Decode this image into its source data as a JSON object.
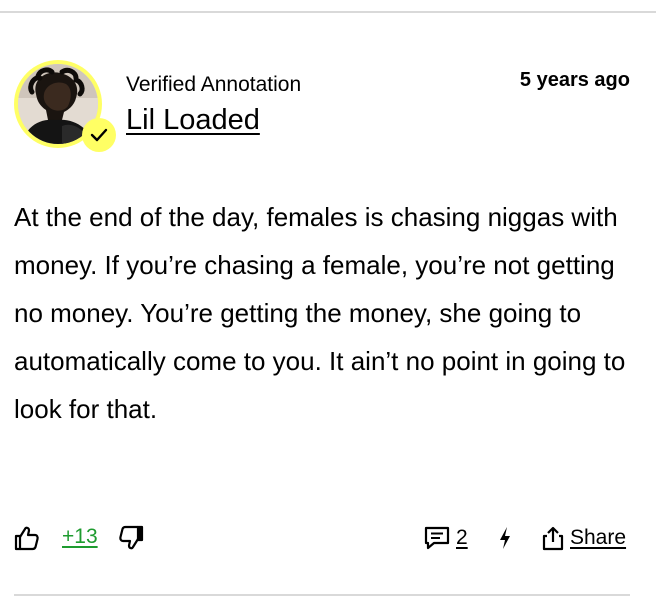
{
  "annotation": {
    "verified_label": "Verified Annotation",
    "author_name": "Lil Loaded",
    "timestamp": "5 years ago",
    "body": "At the end of the day, females is chasing niggas with money. If you’re chasing a female, you’re not getting no money. You’re getting the money, she going to automatically come to you. It ain’t no point in going to look for that."
  },
  "footer": {
    "vote_count": "+13",
    "comments_count": "2",
    "share_label": "Share"
  },
  "icons": {
    "upvote": "thumbs-up-icon",
    "downvote": "thumbs-down-icon",
    "comments": "comment-icon",
    "boost": "lightning-icon",
    "share": "share-icon",
    "verified": "checkmark-icon"
  },
  "colors": {
    "avatar_ring": "#ffff64",
    "vote_count": "#1e9b2f",
    "divider": "#d9d9d9"
  }
}
